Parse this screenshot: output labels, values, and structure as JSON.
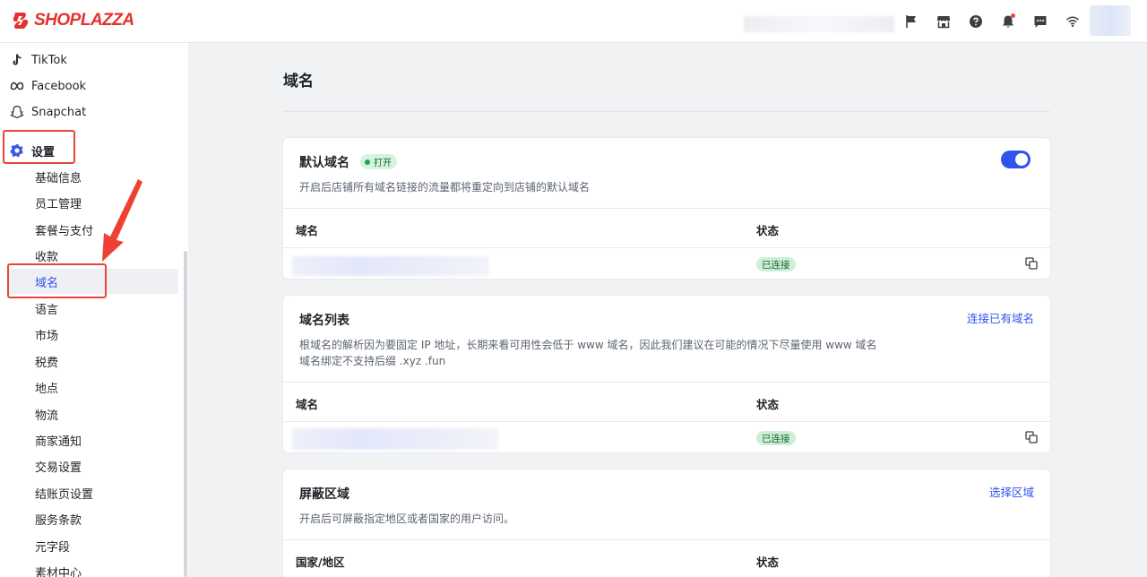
{
  "brand": {
    "name": "SHOPLAZZA",
    "color": "#e5312d"
  },
  "topbar": {
    "icons": [
      "flag-icon",
      "store-icon",
      "help-icon",
      "bell-icon",
      "message-icon",
      "wifi-icon"
    ]
  },
  "sidebar": {
    "channels": [
      {
        "label": "TikTok",
        "icon": "tiktok-icon"
      },
      {
        "label": "Facebook",
        "icon": "meta-icon"
      },
      {
        "label": "Snapchat",
        "icon": "snapchat-icon"
      }
    ],
    "settings_label": "设置",
    "sub_items": [
      "基础信息",
      "员工管理",
      "套餐与支付",
      "收款",
      "域名",
      "语言",
      "市场",
      "税费",
      "地点",
      "物流",
      "商家通知",
      "交易设置",
      "结账页设置",
      "服务条款",
      "元字段",
      "素材中心"
    ],
    "active_item": "域名"
  },
  "main": {
    "title": "域名",
    "default_domain": {
      "title": "默认域名",
      "badge": "打开",
      "toggle_on": true,
      "description": "开启后店铺所有域名链接的流量都将重定向到店铺的默认域名",
      "columns": [
        "域名",
        "状态"
      ],
      "rows": [
        {
          "status": "已连接"
        }
      ]
    },
    "domain_list": {
      "title": "域名列表",
      "link": "连接已有域名",
      "description_line1": "根域名的解析因为要固定 IP 地址，长期来看可用性会低于 www 域名，因此我们建议在可能的情况下尽量使用 www 域名",
      "description_line2": "域名绑定不支持后缀 .xyz .fun",
      "columns": [
        "域名",
        "状态"
      ],
      "rows": [
        {
          "status": "已连接"
        }
      ]
    },
    "blocked_regions": {
      "title": "屏蔽区域",
      "link": "选择区域",
      "description": "开启后可屏蔽指定地区或者国家的用户访问。",
      "columns": [
        "国家/地区",
        "状态"
      ]
    }
  },
  "colors": {
    "accent": "#2f54eb",
    "highlight_box": "#e8453c",
    "status_green": "#cdefd8"
  }
}
